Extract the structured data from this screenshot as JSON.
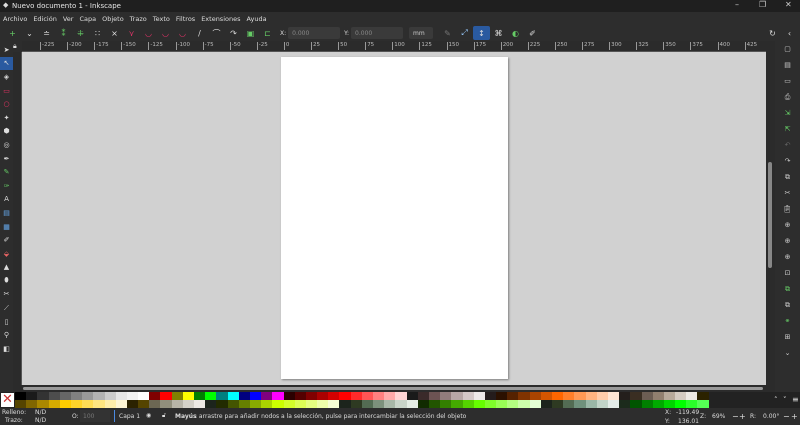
{
  "window": {
    "title": "Nuevo documento 1 - Inkscape",
    "min": "–",
    "max": "❐",
    "close": "✕"
  },
  "menu": [
    "Archivo",
    "Edición",
    "Ver",
    "Capa",
    "Objeto",
    "Trazo",
    "Texto",
    "Filtros",
    "Extensiones",
    "Ayuda"
  ],
  "toolbar": {
    "x_label": "X:",
    "x_value": "0.000",
    "y_label": "Y:",
    "y_value": "0.000",
    "unit": "mm"
  },
  "ruler_labels": [
    "-225",
    "-200",
    "-175",
    "-150",
    "-125",
    "-100",
    "-75",
    "-50",
    "-25",
    "0",
    "25",
    "50",
    "75",
    "100",
    "125",
    "150",
    "175",
    "200",
    "225",
    "250",
    "275",
    "300",
    "325",
    "350",
    "375",
    "400",
    "425"
  ],
  "palette": {
    "row1": [
      "#000000",
      "#1a1a1a",
      "#333333",
      "#4d4d4d",
      "#666666",
      "#808080",
      "#999999",
      "#b3b3b3",
      "#cccccc",
      "#e6e6e6",
      "#f2f2f2",
      "#ffffff",
      "#800000",
      "#ff0000",
      "#808000",
      "#ffff00",
      "#008000",
      "#00ff00",
      "#008080",
      "#00ffff",
      "#000080",
      "#0000ff",
      "#800080",
      "#ff00ff",
      "#2b0000",
      "#550000",
      "#800000",
      "#aa0000",
      "#d40000",
      "#ff0000",
      "#ff2a2a",
      "#ff5555",
      "#ff8080",
      "#ffaaaa",
      "#ffd5d5",
      "#1a1a1a",
      "#3a2a2a",
      "#6c5353",
      "#917c7c",
      "#b7a7a7",
      "#d4c8c8",
      "#ede8e8",
      "#241c1c",
      "#2b1100",
      "#552200",
      "#803300",
      "#aa4400",
      "#d45500",
      "#ff6600",
      "#ff7f2a",
      "#ff9955",
      "#ffb380",
      "#ffccaa",
      "#ffe6d5",
      "#241f1c",
      "#3a2e22",
      "#6c5d53",
      "#917f6f",
      "#b7a99a",
      "#d4cbc1",
      "#ede9e4",
      "#2b2200"
    ],
    "row2": [
      "#554400",
      "#806600",
      "#aa8800",
      "#d4aa00",
      "#ffcc00",
      "#ffd42a",
      "#ffdd55",
      "#ffe680",
      "#ffeeaa",
      "#fff6d5",
      "#2b2200",
      "#554400",
      "#6c6753",
      "#918f7c",
      "#b7b4a7",
      "#d4d1c8",
      "#ede9e4",
      "#1c241c",
      "#222b00",
      "#445500",
      "#668000",
      "#88aa00",
      "#aad400",
      "#ccff00",
      "#d4ff2a",
      "#ddff55",
      "#e5ff80",
      "#eeffaa",
      "#f6ffd5",
      "#1c241c",
      "#2e3a22",
      "#536c53",
      "#7c917c",
      "#a7b7a7",
      "#c8d4c8",
      "#e4ede4",
      "#112b00",
      "#225500",
      "#338000",
      "#44aa00",
      "#55d400",
      "#66ff00",
      "#7fff2a",
      "#99ff55",
      "#b3ff80",
      "#ccffaa",
      "#e5ffd5",
      "#1c241c",
      "#2e3a22",
      "#536c53",
      "#6f917c",
      "#9ab7a7",
      "#c1d4c8",
      "#e4ede9",
      "#1c2b1c",
      "#005500",
      "#008000",
      "#00aa00",
      "#00d400",
      "#00ff00",
      "#2aff2a",
      "#55ff55"
    ]
  },
  "status": {
    "fill_label": "Relleno:",
    "fill_value": "N/D",
    "stroke_label": "Trazo:",
    "stroke_value": "N/D",
    "opacity_label": "O:",
    "opacity_value": "100",
    "layer": "Capa 1",
    "message_bold": "Mayús",
    "message": ": arrastre para añadir nodos a la selección, pulse para intercambiar la selección del objeto",
    "x_label": "X:",
    "x_value": "-119.49",
    "y_label": "Y:",
    "y_value": "136.01",
    "zoom_label": "Z:",
    "zoom_value": "69%",
    "rot_label": "R:",
    "rot_value": "0.00°"
  }
}
